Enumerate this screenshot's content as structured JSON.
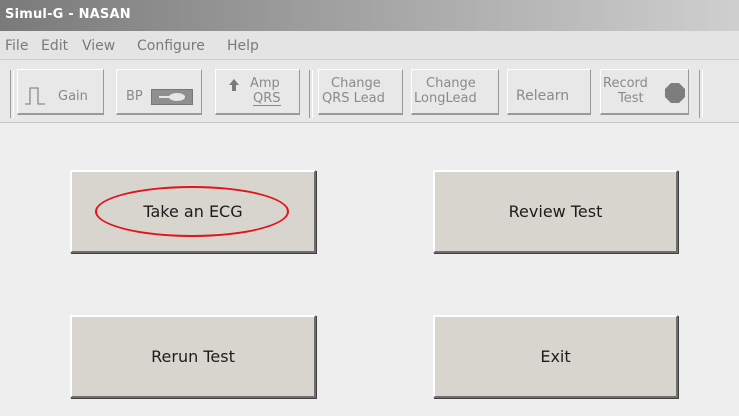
{
  "window": {
    "title": "Simul-G - NASAN"
  },
  "menu": {
    "items": [
      "File",
      "Edit",
      "View",
      "Configure",
      "Help"
    ]
  },
  "toolbar": {
    "gain": "Gain",
    "bp": "BP",
    "amp_line1": "Amp",
    "amp_line2": "QRS",
    "change_qrs_line1": "Change",
    "change_qrs_line2": "QRS Lead",
    "change_long_line1": "Change",
    "change_long_line2": "LongLead",
    "relearn": "Relearn",
    "record_line1": "Record",
    "record_line2": "Test"
  },
  "buttons": {
    "take_ecg": "Take an ECG",
    "review_test": "Review Test",
    "rerun_test": "Rerun Test",
    "exit": "Exit"
  },
  "colors": {
    "annotation_circle": "#e0141a"
  }
}
